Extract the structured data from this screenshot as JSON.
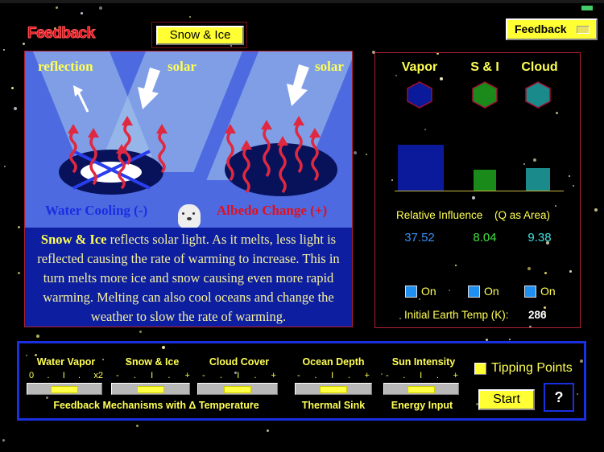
{
  "app": {
    "title": "Feedback",
    "selected_feedback": "Snow & Ice",
    "mode_button": "Feedback"
  },
  "illustration": {
    "label_reflection": "reflection",
    "label_solar_left": "solar",
    "label_solar_right": "solar",
    "caption_left": "Water Cooling (-)",
    "caption_right": "Albedo Change (+)",
    "caption_left_color": "#1a2ee0",
    "caption_right_color": "#e01020",
    "description_bold": "Snow & Ice",
    "description_rest": " reflects solar light. As it melts, less light is reflected causing the rate of warming to increase. This in turn melts more ice and snow causing even more rapid warming. Melting can also cool oceans and change the weather to slow the rate of warming."
  },
  "influence": {
    "columns": [
      {
        "name": "Vapor",
        "value": "37.52",
        "color": "#0a1a9a",
        "text_color": "#3a90f0",
        "enabled_label": "On",
        "relative": 37.52
      },
      {
        "name": "S & I",
        "value": "8.04",
        "color": "#1a8a1a",
        "text_color": "#40e040",
        "enabled_label": "On",
        "relative": 8.04
      },
      {
        "name": "Cloud",
        "value": "9.38",
        "color": "#1a8a8a",
        "text_color": "#40e0e0",
        "enabled_label": "On",
        "relative": 9.38
      }
    ],
    "relative_label": "Relative Influence",
    "area_label": "(Q as Area)",
    "temp_label": "Initial Earth Temp (K):",
    "temp_value": "286"
  },
  "controls": {
    "sliders": [
      {
        "label": "Water Vapor",
        "ticks": [
          "0",
          ".",
          "I",
          ".",
          "x2"
        ],
        "value": 0.5
      },
      {
        "label": "Snow & Ice",
        "ticks": [
          "-",
          ".",
          "I",
          ".",
          "+"
        ],
        "value": 0.5
      },
      {
        "label": "Cloud Cover",
        "ticks": [
          "-",
          ".",
          "I",
          ".",
          "+"
        ],
        "value": 0.5
      },
      {
        "label": "Ocean Depth",
        "ticks": [
          "-",
          ".",
          "I",
          ".",
          "+"
        ],
        "value": 0.5,
        "sublabel": "Thermal Sink"
      },
      {
        "label": "Sun Intensity",
        "ticks": [
          "-",
          ".",
          "I",
          ".",
          "+"
        ],
        "value": 0.5,
        "sublabel": "Energy Input"
      }
    ],
    "group_label": "Feedback Mechanisms with Δ Temperature",
    "tipping_label": "Tipping Points",
    "start_label": "Start",
    "help_label": "?"
  }
}
